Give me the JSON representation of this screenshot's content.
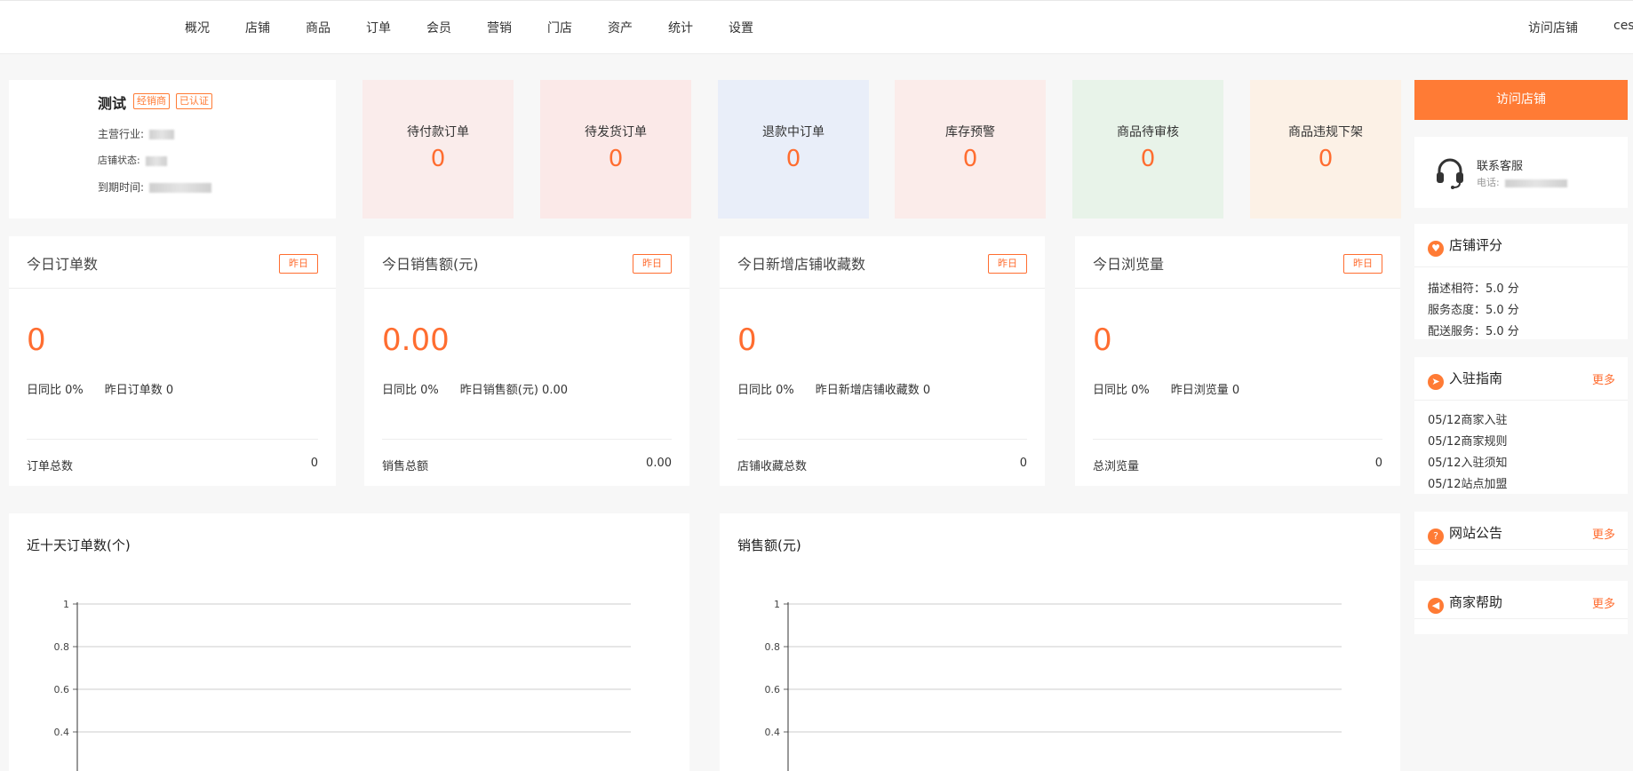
{
  "nav": {
    "items": [
      "概况",
      "店铺",
      "商品",
      "订单",
      "会员",
      "营销",
      "门店",
      "资产",
      "统计",
      "设置"
    ],
    "visit_store": "访问店铺",
    "user": "ces"
  },
  "shop": {
    "name": "测试",
    "tags": [
      "经销商",
      "已认证"
    ],
    "industry_label": "主营行业:",
    "status_label": "店铺状态:",
    "expire_label": "到期时间:"
  },
  "pending": [
    {
      "label": "待付款订单",
      "value": "0",
      "color": "#faeceb"
    },
    {
      "label": "待发货订单",
      "value": "0",
      "color": "#fbe9e8"
    },
    {
      "label": "退款中订单",
      "value": "0",
      "color": "#e9eef9"
    },
    {
      "label": "库存预警",
      "value": "0",
      "color": "#fbecea"
    },
    {
      "label": "商品待审核",
      "value": "0",
      "color": "#e8f3e9"
    },
    {
      "label": "商品违规下架",
      "value": "0",
      "color": "#fcf1e6"
    }
  ],
  "stats": [
    {
      "title": "今日订单数",
      "btn": "昨日",
      "value": "0",
      "ratio": "日同比 0%",
      "yesterday": "昨日订单数 0",
      "total_label": "订单总数",
      "total_value": "0"
    },
    {
      "title": "今日销售额(元)",
      "btn": "昨日",
      "value": "0.00",
      "ratio": "日同比 0%",
      "yesterday": "昨日销售额(元) 0.00",
      "total_label": "销售总额",
      "total_value": "0.00"
    },
    {
      "title": "今日新增店铺收藏数",
      "btn": "昨日",
      "value": "0",
      "ratio": "日同比 0%",
      "yesterday": "昨日新增店铺收藏数 0",
      "total_label": "店铺收藏总数",
      "total_value": "0"
    },
    {
      "title": "今日浏览量",
      "btn": "昨日",
      "value": "0",
      "ratio": "日同比 0%",
      "yesterday": "昨日浏览量 0",
      "total_label": "总浏览量",
      "total_value": "0"
    }
  ],
  "charts": [
    {
      "title": "近十天订单数(个)"
    },
    {
      "title": "销售额(元)"
    }
  ],
  "chart_data": [
    {
      "type": "line",
      "title": "近十天订单数(个)",
      "xlabel": "",
      "ylabel": "",
      "ylim": [
        0,
        1
      ],
      "yticks": [
        "1",
        "0.8",
        "0.6",
        "0.4"
      ],
      "series": []
    },
    {
      "type": "line",
      "title": "销售额(元)",
      "xlabel": "",
      "ylabel": "",
      "ylim": [
        0,
        1
      ],
      "yticks": [
        "1",
        "0.8",
        "0.6",
        "0.4"
      ],
      "series": []
    }
  ],
  "right": {
    "visit_btn": "访问店铺",
    "contact_title": "联系客服",
    "contact_phone_label": "电话:",
    "rating_title": "店铺评分",
    "ratings": [
      "描述相符：5.0 分",
      "服务态度：5.0 分",
      "配送服务：5.0 分"
    ],
    "guide_title": "入驻指南",
    "more": "更多",
    "guide_items": [
      "05/12商家入驻",
      "05/12商家规则",
      "05/12入驻须知",
      "05/12站点加盟"
    ],
    "notice_title": "网站公告",
    "help_title": "商家帮助"
  }
}
